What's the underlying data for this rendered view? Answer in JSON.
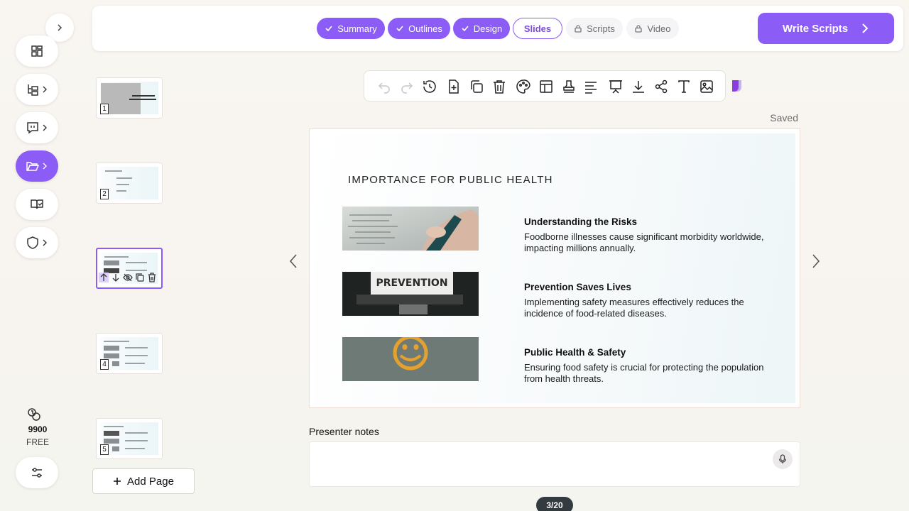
{
  "colors": {
    "accent": "#8b5cf6",
    "accent_text": "#7c4ddb",
    "dark_badge": "#333a40"
  },
  "sidebar": {
    "items": [
      {
        "icon": "dashboard-icon",
        "has_chevron": false,
        "active": false
      },
      {
        "icon": "outline-tree-icon",
        "has_chevron": true,
        "active": false
      },
      {
        "icon": "chat-icon",
        "has_chevron": true,
        "active": false
      },
      {
        "icon": "folder-open-icon",
        "has_chevron": true,
        "active": true
      },
      {
        "icon": "book-check-icon",
        "has_chevron": false,
        "active": false
      },
      {
        "icon": "shield-icon",
        "has_chevron": true,
        "active": false
      }
    ],
    "credits": {
      "value": "9900",
      "plan": "FREE"
    }
  },
  "steps": [
    {
      "label": "Summary",
      "state": "done"
    },
    {
      "label": "Outlines",
      "state": "done"
    },
    {
      "label": "Design",
      "state": "done"
    },
    {
      "label": "Slides",
      "state": "current"
    },
    {
      "label": "Scripts",
      "state": "locked"
    },
    {
      "label": "Video",
      "state": "locked"
    }
  ],
  "header": {
    "write_scripts_label": "Write Scripts"
  },
  "toolbar": {
    "tools": [
      "undo-icon",
      "redo-icon",
      "history-icon",
      "add-slide-icon",
      "duplicate-icon",
      "delete-icon",
      "palette-icon",
      "layout-icon",
      "stamp-icon",
      "align-icon",
      "present-icon",
      "download-icon",
      "share-icon",
      "text-icon",
      "image-icon"
    ],
    "saved_label": "Saved"
  },
  "thumbnails": {
    "items": [
      {
        "number": "1"
      },
      {
        "number": "2"
      },
      {
        "number": "3"
      },
      {
        "number": "4"
      },
      {
        "number": "5"
      }
    ],
    "add_page_label": "Add Page"
  },
  "slide": {
    "title": "IMPORTANCE FOR PUBLIC HEALTH",
    "points": [
      {
        "title": "Understanding the Risks",
        "body": "Foodborne illnesses cause significant morbidity worldwide, impacting millions annually."
      },
      {
        "title": "Prevention Saves Lives",
        "body": "Implementing safety measures effectively reduces the incidence of food-related diseases."
      },
      {
        "title": "Public Health & Safety",
        "body": "Ensuring food safety is crucial for protecting the population from health threats."
      }
    ],
    "image_text": "PREVENTION"
  },
  "notes": {
    "label": "Presenter notes",
    "value": ""
  },
  "pagination": {
    "label": "3/20"
  }
}
